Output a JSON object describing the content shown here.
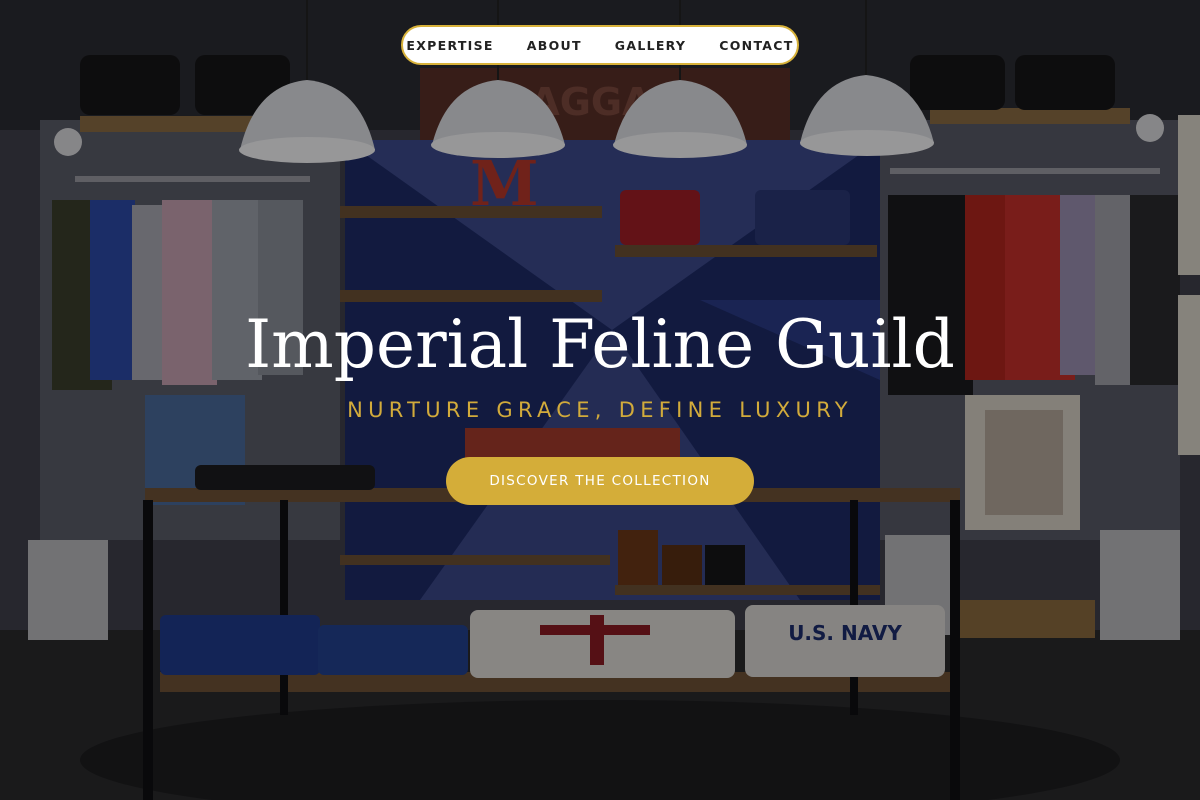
{
  "nav": {
    "items": [
      {
        "label": "EXPERTISE"
      },
      {
        "label": "ABOUT"
      },
      {
        "label": "GALLERY"
      },
      {
        "label": "CONTACT"
      }
    ]
  },
  "hero": {
    "title": "Imperial Feline Guild",
    "subtitle": "NURTURE GRACE, DEFINE LUXURY",
    "cta_label": "DISCOVER THE COLLECTION",
    "background_image": "boutique-store-interior-photo",
    "store_sign_text": "BAGGAGE",
    "shirt_print_text": "U.S. NAVY"
  },
  "colors": {
    "accent_gold": "#d4ad39",
    "nav_background": "#ffffff",
    "title_color": "#ffffff"
  }
}
